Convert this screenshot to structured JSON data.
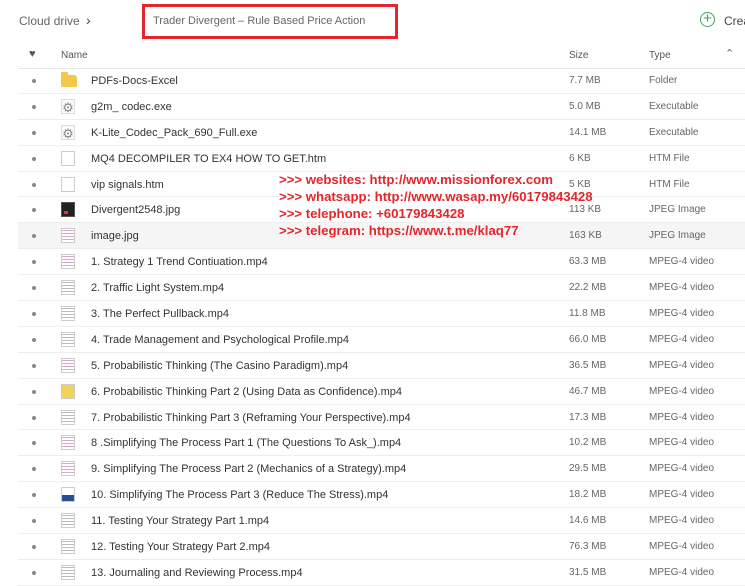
{
  "breadcrumb": {
    "root": "Cloud drive",
    "separator": "›",
    "current": "Trader Divergent – Rule Based Price Action"
  },
  "actions": {
    "create_label": "Crea"
  },
  "columns": {
    "name": "Name",
    "size": "Size",
    "type": "Type"
  },
  "files": [
    {
      "name": "PDFs-Docs-Excel",
      "size": "7.7 MB",
      "type": "Folder",
      "icon": "folder-icon"
    },
    {
      "name": "g2m_ codec.exe",
      "size": "5.0 MB",
      "type": "Executable",
      "icon": "gear-icon"
    },
    {
      "name": "K-Lite_Codec_Pack_690_Full.exe",
      "size": "14.1 MB",
      "type": "Executable",
      "icon": "gear-icon"
    },
    {
      "name": "MQ4 DECOMPILER TO EX4 HOW TO GET.htm",
      "size": "6 KB",
      "type": "HTM File",
      "icon": "document-icon"
    },
    {
      "name": "vip signals.htm",
      "size": "5 KB",
      "type": "HTM File",
      "icon": "document-icon"
    },
    {
      "name": "Divergent2548.jpg",
      "size": "113 KB",
      "type": "JPEG Image",
      "icon": "image-thumbnail-icon"
    },
    {
      "name": "image.jpg",
      "size": "163 KB",
      "type": "JPEG Image",
      "icon": "image-thumbnail-icon"
    },
    {
      "name": "1. Strategy 1 Trend Contiuation.mp4",
      "size": "63.3 MB",
      "type": "MPEG-4 video",
      "icon": "video-thumbnail-icon"
    },
    {
      "name": "2. Traffic Light System.mp4",
      "size": "22.2 MB",
      "type": "MPEG-4 video",
      "icon": "video-thumbnail-icon"
    },
    {
      "name": "3. The Perfect Pullback.mp4",
      "size": "11.8 MB",
      "type": "MPEG-4 video",
      "icon": "video-thumbnail-icon"
    },
    {
      "name": "4. Trade Management and Psychological Profile.mp4",
      "size": "66.0 MB",
      "type": "MPEG-4 video",
      "icon": "video-thumbnail-icon"
    },
    {
      "name": "5. Probabilistic Thinking (The Casino Paradigm).mp4",
      "size": "36.5 MB",
      "type": "MPEG-4 video",
      "icon": "video-thumbnail-icon"
    },
    {
      "name": "6. Probabilistic Thinking Part 2 (Using Data as Confidence).mp4",
      "size": "46.7 MB",
      "type": "MPEG-4 video",
      "icon": "video-thumbnail-icon"
    },
    {
      "name": "7. Probabilistic Thinking Part 3 (Reframing Your Perspective).mp4",
      "size": "17.3 MB",
      "type": "MPEG-4 video",
      "icon": "video-thumbnail-icon"
    },
    {
      "name": "8 .Simplifying The Process Part 1 (The Questions To Ask_).mp4",
      "size": "10.2 MB",
      "type": "MPEG-4 video",
      "icon": "video-thumbnail-icon"
    },
    {
      "name": "9. Simplifying The Process Part 2 (Mechanics of a Strategy).mp4",
      "size": "29.5 MB",
      "type": "MPEG-4 video",
      "icon": "video-thumbnail-icon"
    },
    {
      "name": "10. Simplifying The Process Part 3 (Reduce The Stress).mp4",
      "size": "18.2 MB",
      "type": "MPEG-4 video",
      "icon": "video-thumbnail-icon"
    },
    {
      "name": "11. Testing Your Strategy Part 1.mp4",
      "size": "14.6 MB",
      "type": "MPEG-4 video",
      "icon": "video-thumbnail-icon"
    },
    {
      "name": "12. Testing Your Strategy Part 2.mp4",
      "size": "76.3 MB",
      "type": "MPEG-4 video",
      "icon": "video-thumbnail-icon"
    },
    {
      "name": "13. Journaling and Reviewing Process.mp4",
      "size": "31.5 MB",
      "type": "MPEG-4 video",
      "icon": "video-thumbnail-icon"
    }
  ],
  "overlay_lines": [
    ">>> websites: http://www.missionforex.com",
    ">>> whatsapp: http://www.wasap.my/60179843428",
    ">>> telephone: +60179843428",
    ">>> telegram: https://www.t.me/klaq77"
  ],
  "colors": {
    "highlight_border": "#e3262c",
    "overlay_text": "#e3262c",
    "create_icon": "#3aa35b",
    "folder": "#f2c94c"
  }
}
